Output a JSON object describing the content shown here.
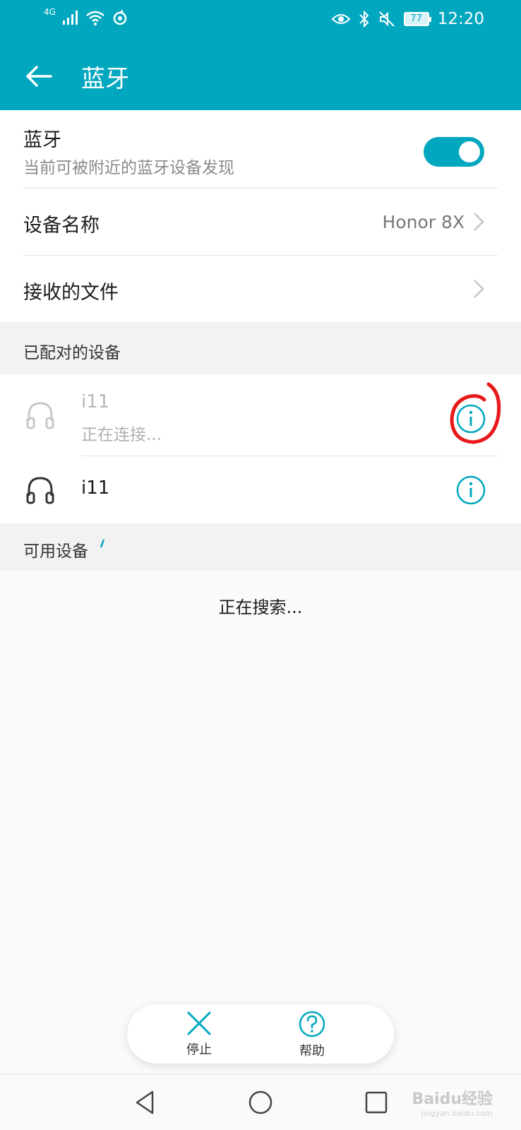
{
  "status_bar": {
    "network": "4G",
    "battery": "77",
    "time": "12:20"
  },
  "toolbar": {
    "title": "蓝牙"
  },
  "bluetooth_row": {
    "title": "蓝牙",
    "subtitle": "当前可被附近的蓝牙设备发现",
    "enabled": true
  },
  "device_name_row": {
    "title": "设备名称",
    "value": "Honor 8X"
  },
  "received_files_row": {
    "title": "接收的文件"
  },
  "paired_section": {
    "header": "已配对的设备",
    "devices": [
      {
        "name": "i11",
        "status": "正在连接..."
      },
      {
        "name": "i11",
        "status": ""
      }
    ]
  },
  "available_section": {
    "header": "可用设备",
    "searching": "正在搜索..."
  },
  "action_bar": {
    "stop_label": "停止",
    "help_label": "帮助"
  },
  "watermark": {
    "brand": "Baidu经验",
    "url": "jingyan.baidu.com"
  },
  "colors": {
    "accent": "#00a7bf",
    "annotation": "#e8191b"
  }
}
